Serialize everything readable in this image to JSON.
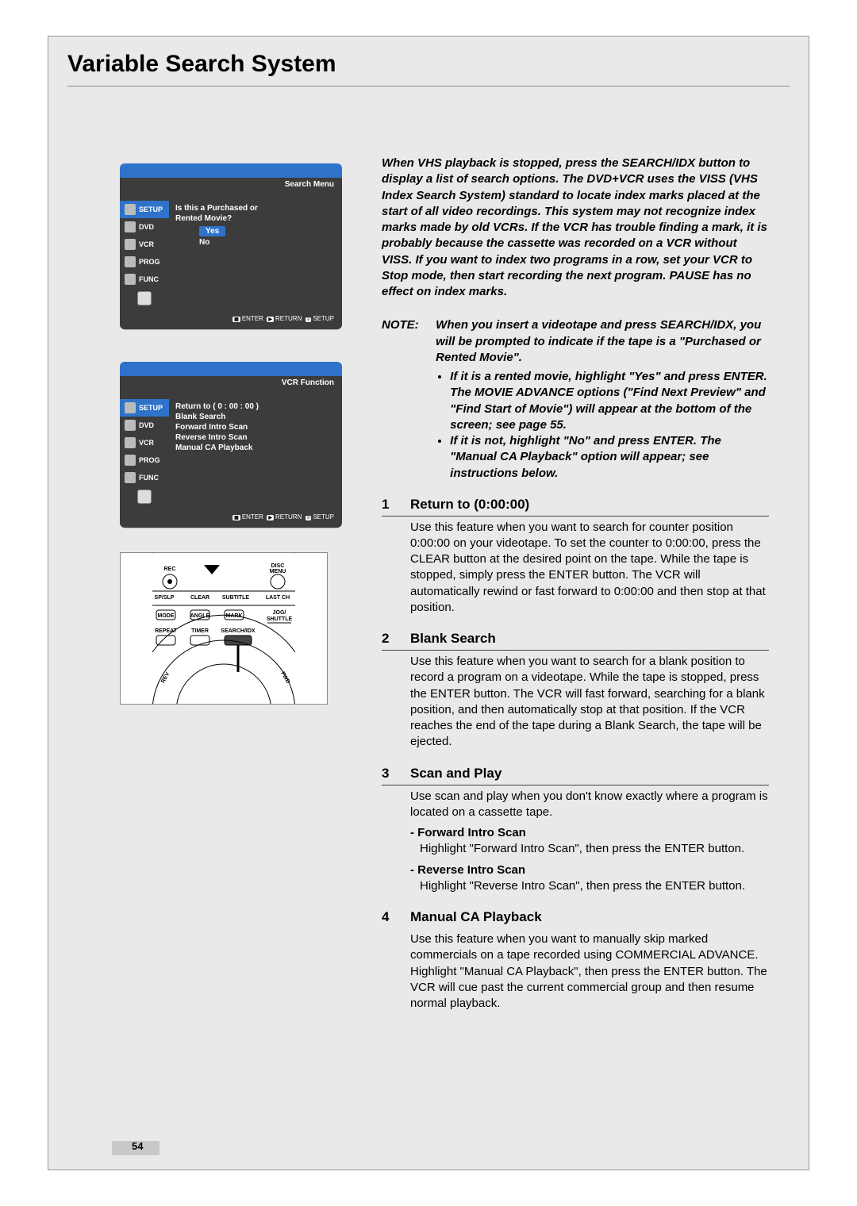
{
  "page": {
    "title": "Variable Search System",
    "number": "54"
  },
  "screen_labels": {
    "setup": "SETUP",
    "dvd": "DVD",
    "vcr": "VCR",
    "prog": "PROG",
    "func": "FUNC",
    "footer_enter": "ENTER",
    "footer_return": "RETURN",
    "footer_setup": "SETUP"
  },
  "screen1": {
    "header": "Search Menu",
    "prompt_line1": "Is this a Purchased or",
    "prompt_line2": "Rented Movie?",
    "yes": "Yes",
    "no": "No"
  },
  "screen2": {
    "header": "VCR Function",
    "items": {
      "returnto": "Return to ( 0 : 00 : 00 )",
      "blank": "Blank Search",
      "fwd": "Forward Intro Scan",
      "rev": "Reverse Intro Scan",
      "manual": "Manual CA Playback"
    }
  },
  "remote": {
    "rec": "REC",
    "disc_menu1": "DISC",
    "disc_menu2": "MENU",
    "spslp": "SP/SLP",
    "clear": "CLEAR",
    "subtitle": "SUBTITLE",
    "lastch": "LAST CH",
    "mode": "MODE",
    "angle": "ANGLE",
    "mark": "MARK",
    "jog1": "JOG/",
    "jog2": "SHUTTLE",
    "repeat": "REPEAT",
    "timer": "TIMER",
    "search": "SEARCH/IDX",
    "rev": "REV",
    "fwd": "FWD"
  },
  "intro": "When VHS playback is stopped, press the SEARCH/IDX button to display a list of search options. The DVD+VCR uses the VISS (VHS Index Search System) standard to locate index marks placed at the start of all video recordings. This system may not recognize index marks made by old VCRs. If the VCR has trouble finding a mark, it is probably because the cassette was recorded on a VCR without VISS. If you want to index two programs in a row, set your VCR to Stop mode, then start recording the next program. PAUSE has no effect on index marks.",
  "note": {
    "label": "NOTE:",
    "lead": "When you insert a videotape and press SEARCH/IDX, you will be prompted to indicate if the tape is a \"Purchased or Rented Movie\".",
    "b1": "If it is a rented movie, highlight \"Yes\" and press ENTER. The MOVIE ADVANCE options (\"Find Next Preview\" and \"Find Start of Movie\") will appear at the bottom of the screen; see page 55.",
    "b2": "If it is not, highlight \"No\" and press ENTER. The \"Manual CA Playback\" option will appear; see instructions below."
  },
  "sections": {
    "s1": {
      "n": "1",
      "title": "Return to (0:00:00)",
      "body": "Use this feature when you want to search for counter position 0:00:00 on your videotape. To set the counter to 0:00:00, press the CLEAR button at the desired point on the tape. While the tape is stopped, simply press the ENTER button. The VCR will automatically rewind or fast forward to 0:00:00 and then stop at that position."
    },
    "s2": {
      "n": "2",
      "title": "Blank Search",
      "body": "Use this feature when you want to search for a blank position to record a program on a videotape. While the tape is stopped, press the ENTER button. The VCR will fast forward, searching for a blank position, and then automatically stop at that position. If the VCR reaches the end of the tape during a Blank Search, the tape will be ejected."
    },
    "s3": {
      "n": "3",
      "title": "Scan and Play",
      "body": "Use scan and play when you don't know exactly where a program is located on a cassette tape.",
      "sub1_t": "- Forward Intro Scan",
      "sub1_b": "Highlight \"Forward Intro Scan\", then press the ENTER button.",
      "sub2_t": "- Reverse Intro Scan",
      "sub2_b": "Highlight \"Reverse Intro Scan\", then press the ENTER button."
    },
    "s4": {
      "n": "4",
      "title": "Manual CA Playback",
      "body": "Use this feature when you want to manually skip marked commercials on a tape recorded using COMMERCIAL ADVANCE. Highlight \"Manual CA Playback\", then press the ENTER button. The VCR will cue past the current commercial group and then resume normal playback."
    }
  }
}
